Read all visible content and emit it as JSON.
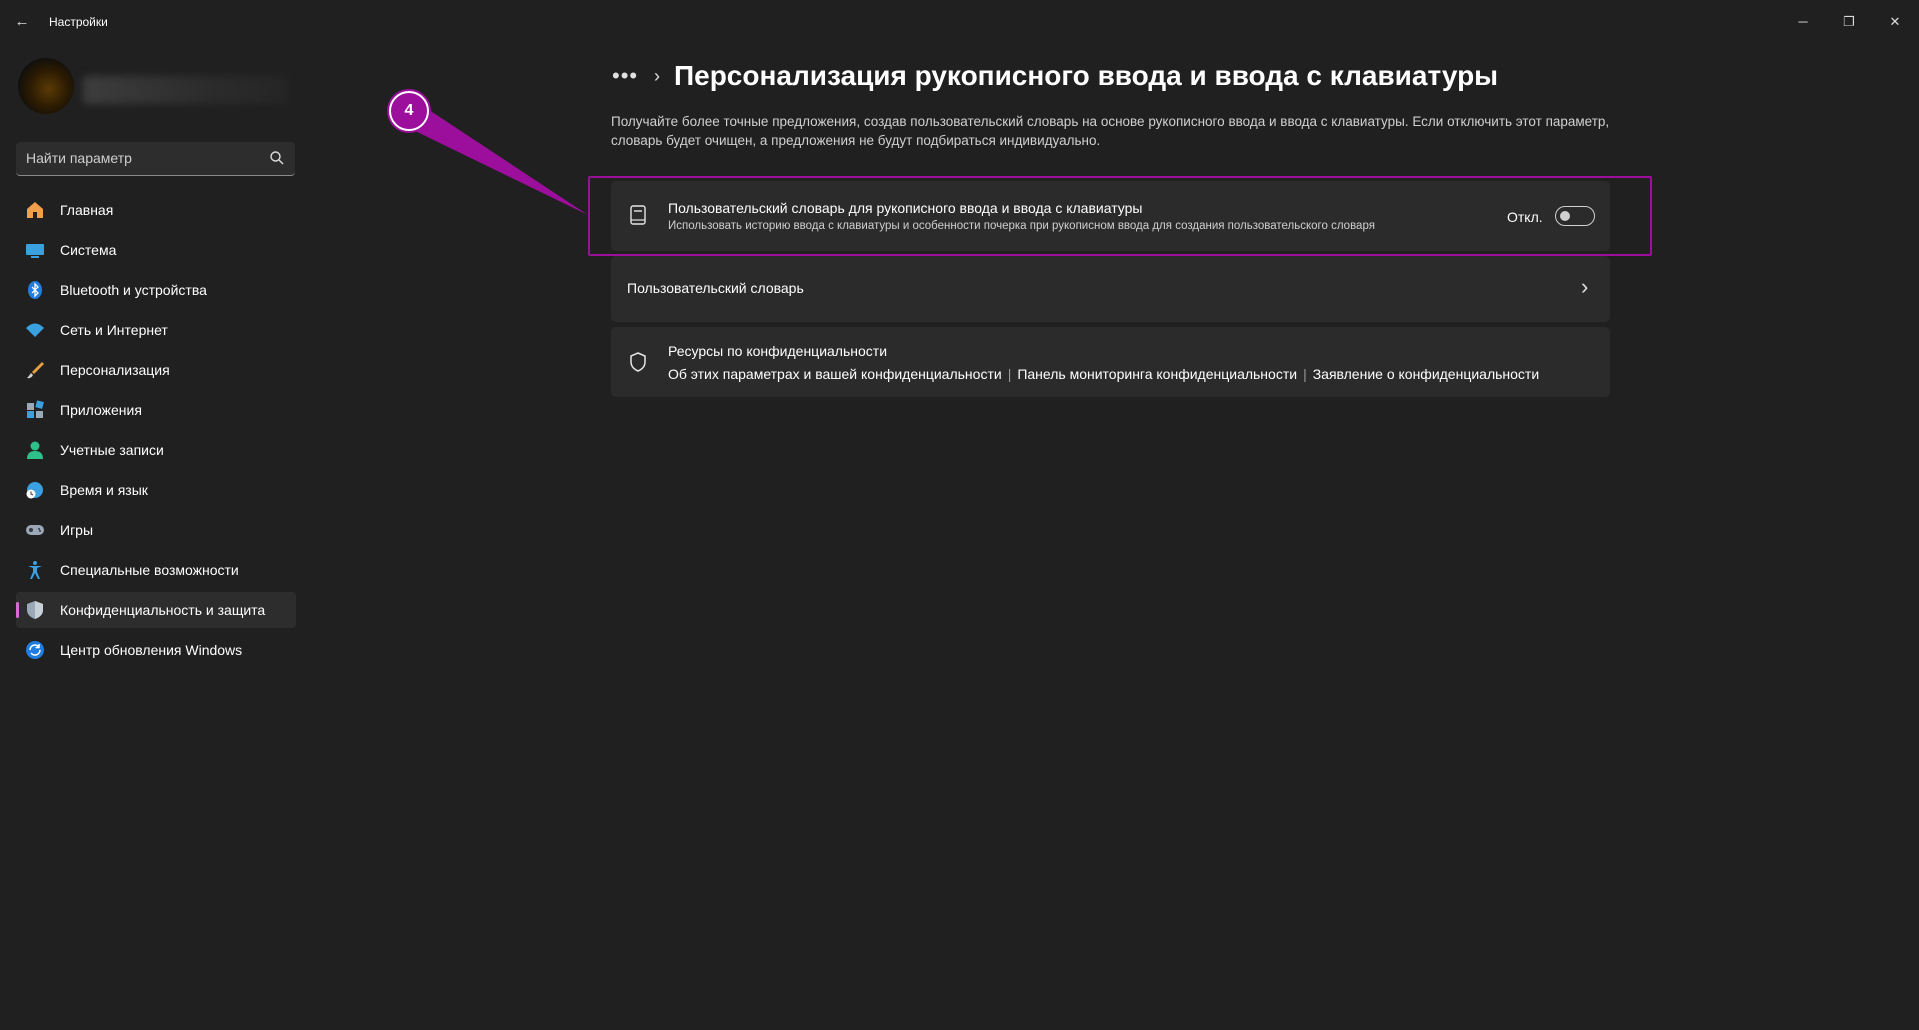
{
  "window": {
    "title": "Настройки",
    "back_icon": "←",
    "controls": {
      "minimize": "─",
      "maximize": "❐",
      "close": "✕"
    }
  },
  "search": {
    "placeholder": "Найти параметр"
  },
  "sidebar": {
    "items": [
      {
        "label": "Главная",
        "icon": "home-icon",
        "active": false
      },
      {
        "label": "Система",
        "icon": "monitor-icon",
        "active": false
      },
      {
        "label": "Bluetooth и устройства",
        "icon": "bluetooth-icon",
        "active": false
      },
      {
        "label": "Сеть и Интернет",
        "icon": "wifi-icon",
        "active": false
      },
      {
        "label": "Персонализация",
        "icon": "brush-icon",
        "active": false
      },
      {
        "label": "Приложения",
        "icon": "apps-icon",
        "active": false
      },
      {
        "label": "Учетные записи",
        "icon": "account-icon",
        "active": false
      },
      {
        "label": "Время и язык",
        "icon": "globe-clock-icon",
        "active": false
      },
      {
        "label": "Игры",
        "icon": "gamepad-icon",
        "active": false
      },
      {
        "label": "Специальные возможности",
        "icon": "accessibility-icon",
        "active": false
      },
      {
        "label": "Конфиденциальность и защита",
        "icon": "shield-icon",
        "active": true
      },
      {
        "label": "Центр обновления Windows",
        "icon": "update-icon",
        "active": false
      }
    ]
  },
  "main": {
    "breadcrumb_more": "•••",
    "breadcrumb_sep": "›",
    "title": "Персонализация рукописного ввода и ввода с клавиатуры",
    "description": "Получайте более точные предложения, создав пользовательский словарь на основе рукописного ввода и ввода с клавиатуры. Если отключить этот параметр, словарь будет очищен, а предложения не будут подбираться индивидуально.",
    "dictionary_setting": {
      "title": "Пользовательский словарь для рукописного ввода и ввода с клавиатуры",
      "subtitle": "Использовать историю ввода с клавиатуры и особенности почерка при рукописном ввода для создания пользовательского словаря",
      "toggle_label": "Откл.",
      "toggle_on": false
    },
    "user_dictionary": {
      "label": "Пользовательский словарь",
      "chevron": "›"
    },
    "privacy": {
      "title": "Ресурсы по конфиденциальности",
      "links": [
        "Об этих параметрах и вашей конфиденциальности",
        "Панель мониторинга конфиденциальности",
        "Заявление о конфиденциальности"
      ],
      "separator": "|"
    }
  },
  "annotation": {
    "step_number": "4",
    "color": "#9c0f9c"
  },
  "colors": {
    "background": "#202020",
    "card": "#2b2b2b",
    "accent": "#d66bd6"
  }
}
